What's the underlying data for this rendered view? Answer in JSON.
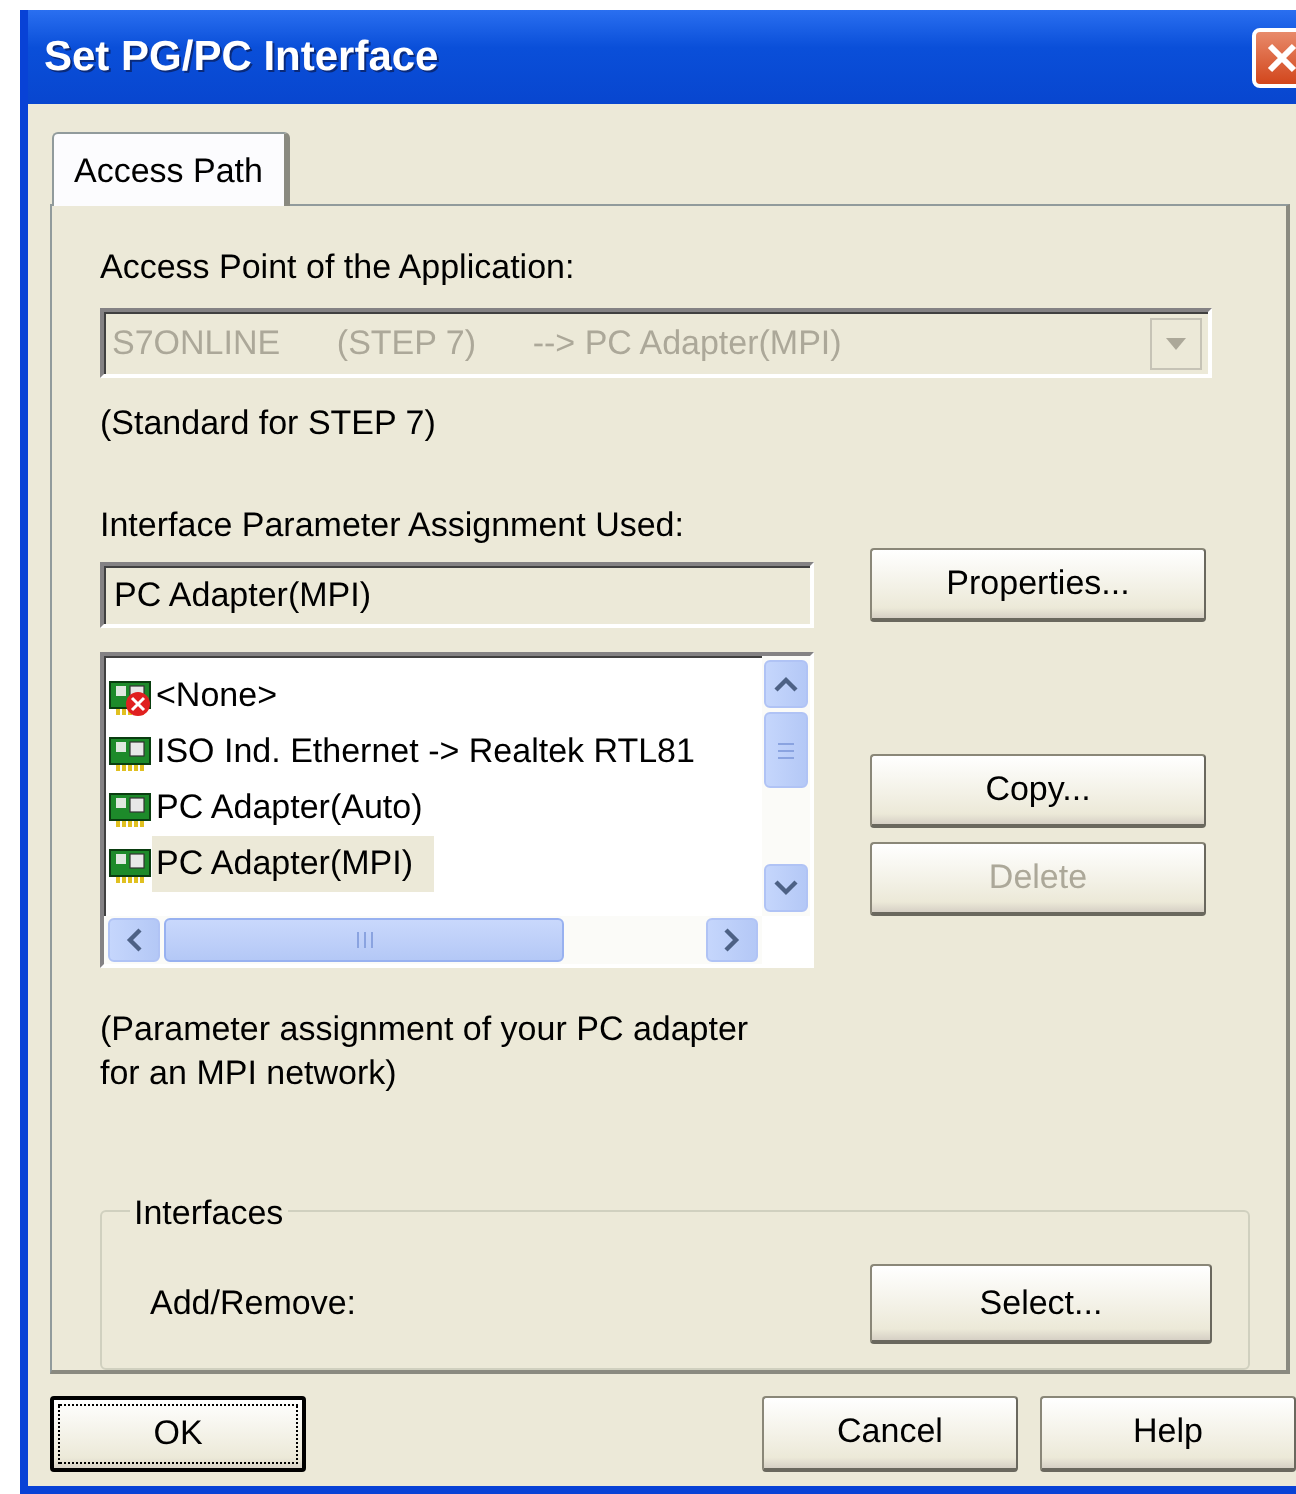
{
  "window": {
    "title": "Set PG/PC Interface"
  },
  "tabs": [
    {
      "label": "Access Path",
      "selected": true
    }
  ],
  "access_point": {
    "label": "Access Point of the Application:",
    "value": "S7ONLINE      (STEP 7)      --> PC Adapter(MPI)",
    "disabled": true,
    "note": "(Standard for STEP 7)"
  },
  "parameter_assignment": {
    "label": "Interface Parameter Assignment Used:",
    "value": "PC Adapter(MPI)",
    "items": [
      {
        "label": "<None>",
        "kind": "none",
        "selected": false
      },
      {
        "label": "ISO Ind. Ethernet -> Realtek RTL81",
        "kind": "adapter",
        "selected": false
      },
      {
        "label": "PC Adapter(Auto)",
        "kind": "adapter",
        "selected": false
      },
      {
        "label": "PC Adapter(MPI)",
        "kind": "adapter",
        "selected": true
      }
    ],
    "description": "(Parameter assignment of your PC adapter for an MPI network)"
  },
  "side_buttons": [
    {
      "label": "Properties...",
      "disabled": false
    },
    {
      "label": "Copy...",
      "disabled": false
    },
    {
      "label": "Delete",
      "disabled": true
    }
  ],
  "interfaces": {
    "title": "Interfaces",
    "label": "Add/Remove:",
    "button": {
      "label": "Select...",
      "disabled": false
    }
  },
  "footer_buttons": [
    {
      "label": "OK",
      "focused": true
    },
    {
      "label": "Cancel",
      "focused": false
    },
    {
      "label": "Help",
      "focused": false
    }
  ]
}
